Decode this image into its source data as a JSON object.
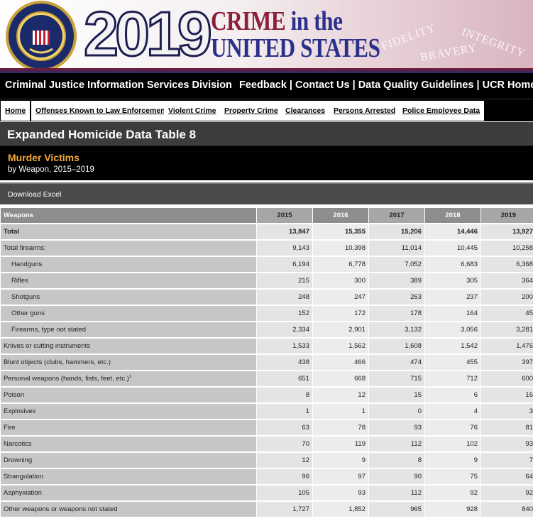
{
  "banner": {
    "year": "2019",
    "title_line1_a": "CRIME",
    "title_line1_b": "in the",
    "title_line2": "UNITED STATES",
    "motto": [
      "FIDELITY",
      "BRAVERY",
      "INTEGRITY"
    ],
    "seal_text": "DEPARTMENT OF JUSTICE · FEDERAL BUREAU OF INVESTIGATION"
  },
  "topnav": {
    "division": "Criminal Justice Information Services Division",
    "links": [
      "Feedback",
      "Contact Us",
      "Data Quality Guidelines",
      "UCR Home"
    ]
  },
  "subnav": {
    "items": [
      "Home",
      "Offenses Known to Law Enforcement",
      "Violent Crime",
      "Property Crime",
      "Clearances",
      "Persons Arrested",
      "Police Employee Data"
    ]
  },
  "page": {
    "title": "Expanded Homicide Data Table 8",
    "table_title": "Murder Victims",
    "table_subtitle": "by Weapon, 2015–2019",
    "download_label": "Download Excel"
  },
  "table": {
    "header_label": "Weapons",
    "years": [
      "2015",
      "2016",
      "2017",
      "2018",
      "2019"
    ],
    "footnote_mark": "1",
    "rows": [
      {
        "label": "Total",
        "values": [
          "13,847",
          "15,355",
          "15,206",
          "14,446",
          "13,927"
        ]
      },
      {
        "label": "Total firearms:",
        "values": [
          "9,143",
          "10,398",
          "11,014",
          "10,445",
          "10,258"
        ]
      },
      {
        "label": "Handguns",
        "values": [
          "6,194",
          "6,778",
          "7,052",
          "6,683",
          "6,368"
        ]
      },
      {
        "label": "Rifles",
        "values": [
          "215",
          "300",
          "389",
          "305",
          "364"
        ]
      },
      {
        "label": "Shotguns",
        "values": [
          "248",
          "247",
          "263",
          "237",
          "200"
        ]
      },
      {
        "label": "Other guns",
        "values": [
          "152",
          "172",
          "178",
          "164",
          "45"
        ]
      },
      {
        "label": "Firearms, type not stated",
        "values": [
          "2,334",
          "2,901",
          "3,132",
          "3,056",
          "3,281"
        ]
      },
      {
        "label": "Knives or cutting instruments",
        "values": [
          "1,533",
          "1,562",
          "1,608",
          "1,542",
          "1,476"
        ]
      },
      {
        "label": "Blunt objects (clubs, hammers, etc.)",
        "values": [
          "438",
          "466",
          "474",
          "455",
          "397"
        ]
      },
      {
        "label": "Personal weapons (hands, fists, feet, etc.)",
        "values": [
          "651",
          "668",
          "715",
          "712",
          "600"
        ]
      },
      {
        "label": "Poison",
        "values": [
          "8",
          "12",
          "15",
          "6",
          "16"
        ]
      },
      {
        "label": "Explosives",
        "values": [
          "1",
          "1",
          "0",
          "4",
          "3"
        ]
      },
      {
        "label": "Fire",
        "values": [
          "63",
          "78",
          "93",
          "76",
          "81"
        ]
      },
      {
        "label": "Narcotics",
        "values": [
          "70",
          "119",
          "112",
          "102",
          "93"
        ]
      },
      {
        "label": "Drowning",
        "values": [
          "12",
          "9",
          "8",
          "9",
          "7"
        ]
      },
      {
        "label": "Strangulation",
        "values": [
          "96",
          "97",
          "90",
          "75",
          "64"
        ]
      },
      {
        "label": "Asphyxiation",
        "values": [
          "105",
          "93",
          "112",
          "92",
          "92"
        ]
      },
      {
        "label": "Other weapons or weapons not stated",
        "values": [
          "1,727",
          "1,852",
          "965",
          "928",
          "840"
        ]
      }
    ]
  }
}
